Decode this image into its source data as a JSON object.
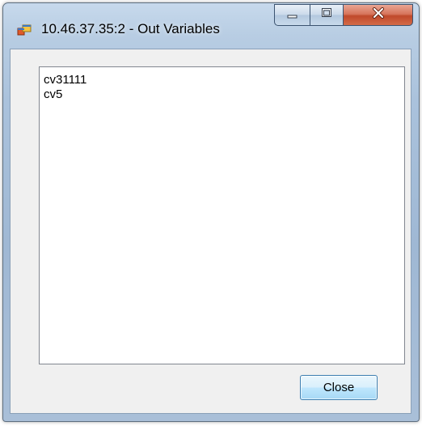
{
  "window": {
    "title": "10.46.37.35:2 - Out Variables",
    "app_icon": "windows-form-icon"
  },
  "caption_buttons": {
    "minimize_icon": "minimize-icon",
    "maximize_icon": "maximize-icon",
    "close_icon": "close-icon"
  },
  "variables_list": {
    "items": [
      "cv31111",
      "cv5"
    ]
  },
  "footer": {
    "close_label": "Close"
  },
  "colors": {
    "frame_accent": "#aac2dc",
    "client_bg": "#f0f0f0",
    "close_caption": "#c0492b",
    "button_focus": "#3c7fb1"
  }
}
